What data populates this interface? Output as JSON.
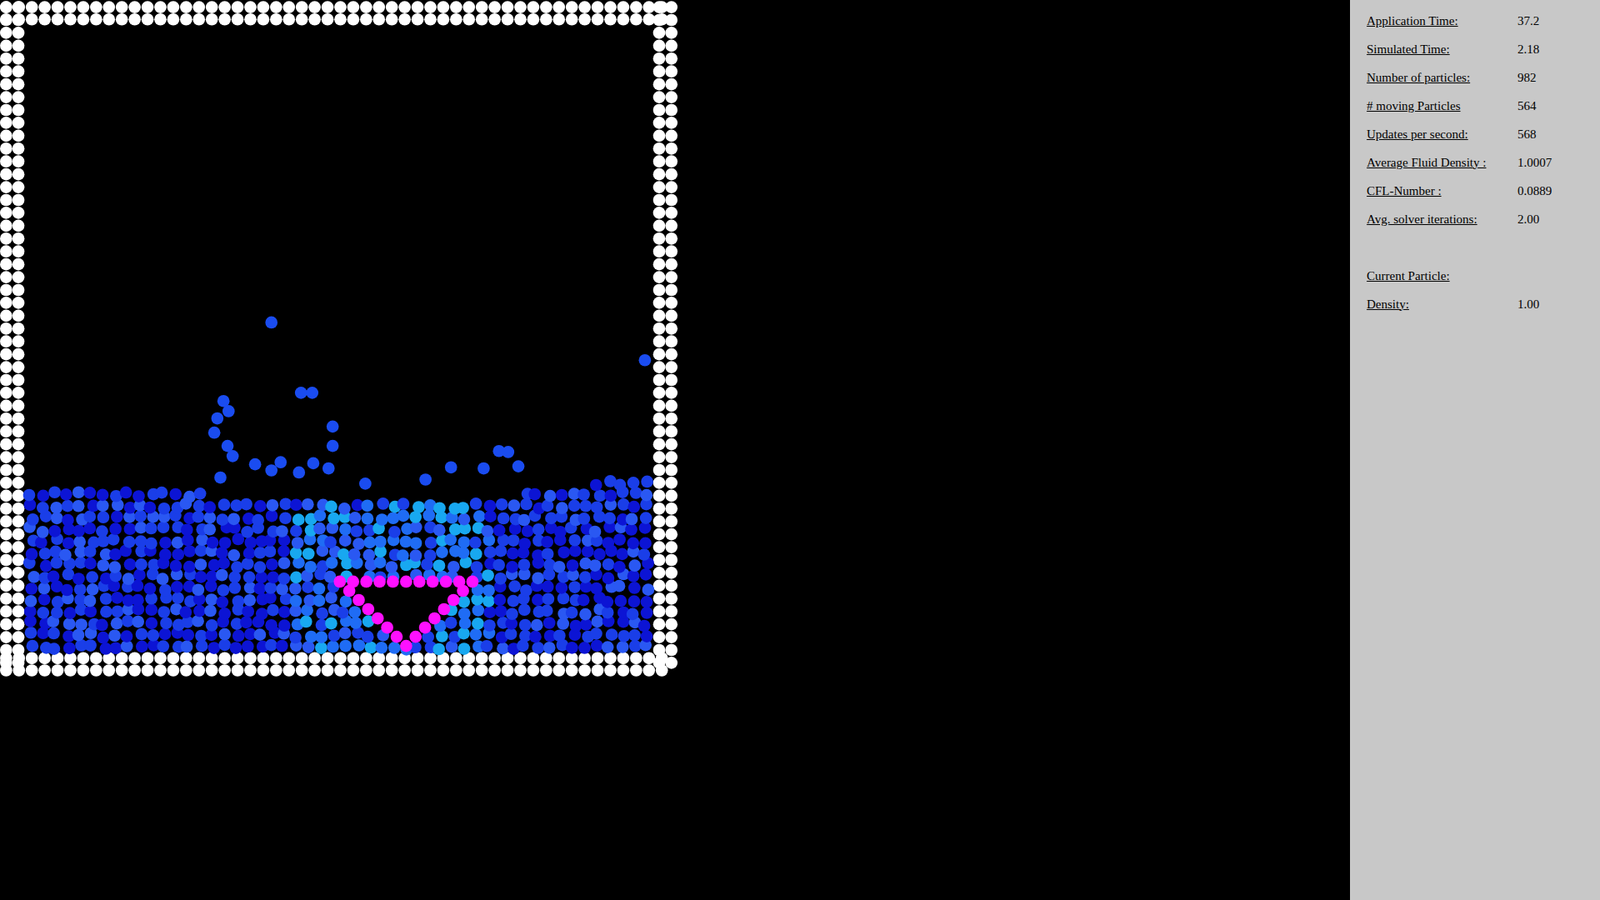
{
  "stats": [
    {
      "label": "Application Time:",
      "value": "37.2"
    },
    {
      "label": "Simulated Time:",
      "value": "2.18"
    },
    {
      "label": "Number of particles:",
      "value": "982"
    },
    {
      "label": "# moving Particles",
      "value": "564"
    },
    {
      "label": "Updates per second:",
      "value": "568"
    },
    {
      "label": "Average Fluid Density :",
      "value": "1.0007"
    },
    {
      "label": "CFL-Number :",
      "value": "0.0889"
    },
    {
      "label": "Avg. solver iterations:",
      "value": "2.00"
    }
  ],
  "current_particle": {
    "title": "Current Particle:",
    "fields": [
      {
        "label": "Density:",
        "value": "1.00"
      }
    ]
  }
}
